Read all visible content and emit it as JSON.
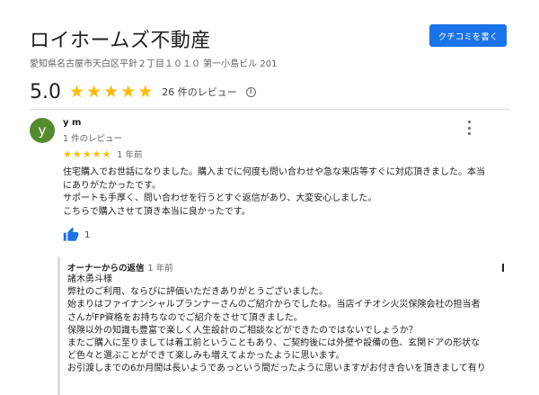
{
  "business": {
    "name": "ロイホームズ不動産",
    "address": "愛知県名古屋市天白区平針２丁目１０１０ 第一小島ビル 201",
    "write_review_label": "クチコミを書く"
  },
  "summary": {
    "score": "5.0",
    "stars": 5,
    "review_count": "26 件のレビュー"
  },
  "review": {
    "avatar_letter": "y",
    "avatar_color": "#558b2f",
    "reviewer_name": "y m",
    "reviewer_meta": "1 件のレビュー",
    "rating": 5,
    "date": "1 年前",
    "lines": [
      "住宅購入でお世話になりました。購入までに何度も問い合わせや急な来店等すぐに対応頂きました。本当",
      "にありがたかったです。",
      "サポートも手厚く、問い合わせを行うとすぐ返信があり、大変安心しました。",
      "こちらで購入させて頂き本当に良かったです。"
    ],
    "like_count": "1"
  },
  "owner_reply": {
    "title": "オーナーからの返信",
    "date": "1 年前",
    "lines": [
      "諸木勇斗様",
      "弊社のご利用、ならびに評価いただきありがとうございました。",
      "始まりはファイナンシャルプランナーさんのご紹介からでしたね。当店イチオシ火災保険会社の担当者",
      "さんがFP資格をお持ちなのでご紹介をさせて頂きました。",
      "保険以外の知識も豊富で楽しく人生設計のご相談などができたのではないでしょうか？",
      "またご購入に至りましては着工前ということもあり、ご契約後には外壁や設備の色、玄関ドアの形状な",
      "ど色々と選ぶことができて楽しみも増えてよかったように思います。",
      "お引渡しまでの6か月間は長いようであっという間だったように思いますがお付き合いを頂きまして有り"
    ]
  },
  "colors": {
    "accent": "#1a73e8",
    "star": "#fbbc04"
  }
}
